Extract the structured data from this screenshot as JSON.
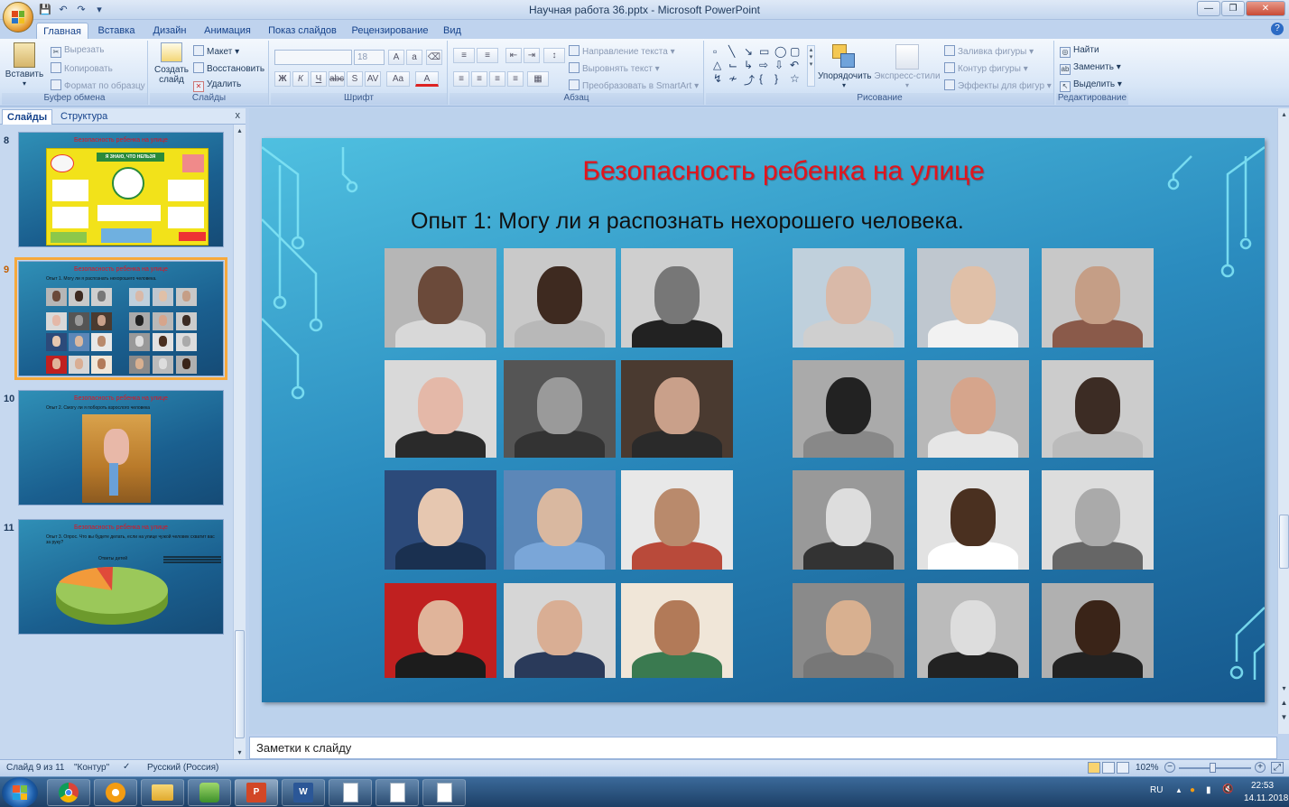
{
  "window": {
    "title": "Научная работа 36.pptx - Microsoft PowerPoint",
    "help": "?"
  },
  "tabs": [
    "Главная",
    "Вставка",
    "Дизайн",
    "Анимация",
    "Показ слайдов",
    "Рецензирование",
    "Вид"
  ],
  "ribbon": {
    "clipboard": {
      "label": "Буфер обмена",
      "paste": "Вставить",
      "cut": "Вырезать",
      "copy": "Копировать",
      "format": "Формат по образцу"
    },
    "slides": {
      "label": "Слайды",
      "create": "Создать слайд",
      "layout": "Макет",
      "reset": "Восстановить",
      "delete": "Удалить"
    },
    "font": {
      "label": "Шрифт",
      "size": "18"
    },
    "paragraph": {
      "label": "Абзац",
      "direction": "Направление текста",
      "align": "Выровнять текст",
      "smartart": "Преобразовать в SmartArt"
    },
    "drawing": {
      "label": "Рисование",
      "arrange": "Упорядочить",
      "styles": "Экспресс-стили",
      "fill": "Заливка фигуры",
      "outline": "Контур фигуры",
      "effects": "Эффекты для фигур"
    },
    "editing": {
      "label": "Редактирование",
      "find": "Найти",
      "replace": "Заменить",
      "select": "Выделить"
    }
  },
  "panel": {
    "tabs": [
      "Слайды",
      "Структура"
    ],
    "close": "x",
    "thumbs": [
      {
        "num": "8",
        "title": "Безопасность ребенка на улице",
        "sub": "",
        "banner": "Я ЗНАЮ, ЧТО НЕЛЬЗЯ"
      },
      {
        "num": "9",
        "title": "Безопасность ребенка на улице",
        "sub": "Опыт 1. Могу ли я распознать нехорошего человека."
      },
      {
        "num": "10",
        "title": "Безопасность ребенка на улице",
        "sub": "Опыт 2. Смогу ли я побороть взрослого человека"
      },
      {
        "num": "11",
        "title": "Безопасность ребенка на улице",
        "sub": "Опыт 3. Опрос. Что вы будете делать, если на улице чужой человек схватит вас за руку?",
        "chart_title": "Ответы детей"
      }
    ]
  },
  "slide": {
    "title": "Безопасность ребенка на улице",
    "subtitle": "Опыт 1: Могу ли я распознать нехорошего человека."
  },
  "notes": {
    "placeholder": "Заметки к слайду"
  },
  "status": {
    "slide_of": "Слайд 9 из 11",
    "theme": "\"Контур\"",
    "lang": "Русский (Россия)",
    "zoom": "102%"
  },
  "taskbar": {
    "lang": "RU",
    "time": "22:53",
    "date": "14.11.2018"
  },
  "colors": {
    "accent": "#f6a93c",
    "title_red": "#e3141c",
    "office_blue": "#15428b"
  }
}
